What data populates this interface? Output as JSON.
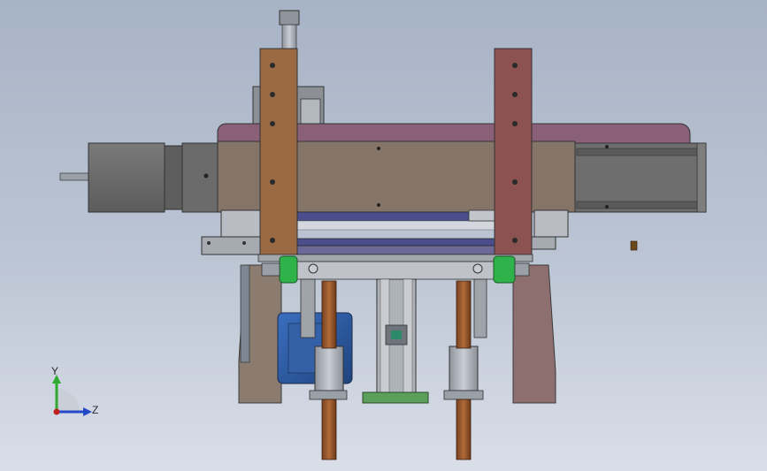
{
  "viewport": {
    "background_top": "#a7b3c6",
    "background_bottom": "#d9dee8"
  },
  "model": {
    "colors": {
      "plate_brown": "#9a6a45",
      "plate_red": "#8c5252",
      "housing": "#857468",
      "housing_top": "#8a5f78",
      "motor": "#6f6f6f",
      "blue_motor": "#2f5aa0",
      "green_roller": "#2fb24a",
      "copper_rod": "#9a5a30",
      "rail_blue": "#4a4e8c",
      "rail_purple": "#6e6898",
      "steel": "#b8bcc4",
      "dark_steel": "#5f636b",
      "base_green": "#5aa05a"
    }
  },
  "triad": {
    "y_label": "Y",
    "z_label": "Z",
    "y_color": "#2eaa2e",
    "z_color": "#2448c8",
    "origin_color": "#c02020"
  }
}
